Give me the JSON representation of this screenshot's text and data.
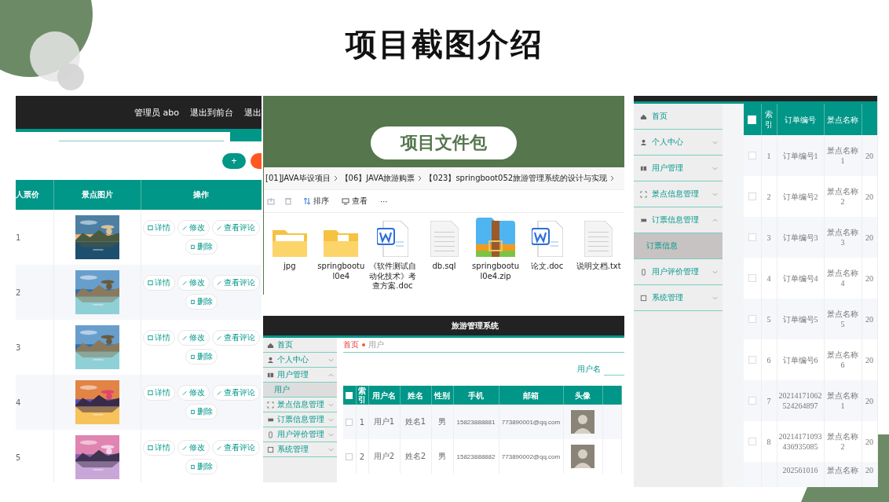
{
  "title": "项目截图介绍",
  "spot_admin": {
    "header_links": [
      "管理员 abo",
      "退出到前台",
      "退出"
    ],
    "add_button": "+",
    "columns": [
      "人票价",
      "景点图片",
      "操作"
    ],
    "rows": [
      {
        "index": "1",
        "image": {
          "kind": "picture"
        },
        "actions": [
          "详情",
          "修改",
          "查看评论",
          "删除"
        ]
      },
      {
        "index": "2",
        "image": {
          "kind": "picture"
        },
        "actions": [
          "详情",
          "修改",
          "查看评论",
          "删除"
        ]
      },
      {
        "index": "3",
        "image": {
          "kind": "picture"
        },
        "actions": [
          "详情",
          "修改",
          "查看评论",
          "删除"
        ]
      },
      {
        "index": "4",
        "image": {
          "kind": "picture"
        },
        "actions": [
          "详情",
          "修改",
          "查看评论",
          "删除"
        ]
      },
      {
        "index": "5",
        "image": {
          "kind": "picture"
        },
        "actions": [
          "详情",
          "修改",
          "查看评论",
          "删除"
        ]
      }
    ]
  },
  "file_package": {
    "banner": "项目文件包",
    "breadcrumb": [
      "[01]JAVA毕设项目",
      "【06】JAVA旅游购票",
      "【023】springboot052旅游管理系统的设计与实现"
    ],
    "sort_button": "排序",
    "view_button": "查看",
    "more_button": "⋯",
    "files": [
      {
        "name": "jpg",
        "kind": "image-folder"
      },
      {
        "name": "springbootul0e4",
        "kind": "folder"
      },
      {
        "name": "《软件测试自动化技术》考查方案.doc",
        "kind": "word"
      },
      {
        "name": "db.sql",
        "kind": "text"
      },
      {
        "name": "springbootul0e4.zip",
        "kind": "zip"
      },
      {
        "name": "论文.doc",
        "kind": "word"
      },
      {
        "name": "说明文档.txt",
        "kind": "text"
      }
    ]
  },
  "user_admin": {
    "app_title": "旅游管理系统",
    "menu": [
      {
        "label": "首页",
        "kind": "link"
      },
      {
        "label": "个人中心",
        "kind": "group",
        "expanded": false
      },
      {
        "label": "用户管理",
        "kind": "group",
        "expanded": true,
        "children": [
          {
            "label": "用户",
            "selected": true
          }
        ]
      },
      {
        "label": "景点信息管理",
        "kind": "group",
        "expanded": false
      },
      {
        "label": "订票信息管理",
        "kind": "group",
        "expanded": false
      },
      {
        "label": "用户评价管理",
        "kind": "group",
        "expanded": false
      },
      {
        "label": "系统管理",
        "kind": "group",
        "expanded": false
      }
    ],
    "breadcrumb": [
      "首页",
      "用户"
    ],
    "search_label": "用户名",
    "select_all_checked": false,
    "columns": [
      "索引",
      "用户名",
      "姓名",
      "性别",
      "手机",
      "邮箱",
      "头像"
    ],
    "rows": [
      {
        "index": "1",
        "username": "用户1",
        "name": "姓名1",
        "gender": "男",
        "phone": "15823888881",
        "email": "773890001@qq.com",
        "checked": false
      },
      {
        "index": "2",
        "username": "用户2",
        "name": "姓名2",
        "gender": "男",
        "phone": "15823888882",
        "email": "773890002@qq.com",
        "checked": false
      }
    ]
  },
  "order_admin": {
    "menu": [
      {
        "label": "首页",
        "kind": "link"
      },
      {
        "label": "个人中心",
        "kind": "group",
        "expanded": false
      },
      {
        "label": "用户管理",
        "kind": "group",
        "expanded": false
      },
      {
        "label": "景点信息管理",
        "kind": "group",
        "expanded": false
      },
      {
        "label": "订票信息管理",
        "kind": "group",
        "expanded": true,
        "children": [
          {
            "label": "订票信息",
            "selected": true
          }
        ]
      },
      {
        "label": "用户评价管理",
        "kind": "group",
        "expanded": false
      },
      {
        "label": "系统管理",
        "kind": "group",
        "expanded": false
      }
    ],
    "columns": [
      "索引",
      "订单编号",
      "景点名称"
    ],
    "select_all_checked": false,
    "rows": [
      {
        "index": "1",
        "order_no": "订单编号1",
        "spot": "景点名称1",
        "column_5": "20",
        "checked": false
      },
      {
        "index": "2",
        "order_no": "订单编号2",
        "spot": "景点名称2",
        "column_5": "20",
        "checked": false
      },
      {
        "index": "3",
        "order_no": "订单编号3",
        "spot": "景点名称3",
        "column_5": "20",
        "checked": false
      },
      {
        "index": "4",
        "order_no": "订单编号4",
        "spot": "景点名称4",
        "column_5": "20",
        "checked": false
      },
      {
        "index": "5",
        "order_no": "订单编号5",
        "spot": "景点名称5",
        "column_5": "20",
        "checked": false
      },
      {
        "index": "6",
        "order_no": "订单编号6",
        "spot": "景点名称6",
        "column_5": "20",
        "checked": false
      },
      {
        "index": "7",
        "order_no": "20214171062524264897",
        "spot": "景点名称1",
        "column_5": "20",
        "checked": false
      },
      {
        "index": "8",
        "order_no": "20214171093436935085",
        "spot": "景点名称2",
        "column_5": "20",
        "checked": false
      },
      {
        "order_no": "202561016",
        "spot": "景点名称",
        "column_5": "20"
      }
    ]
  }
}
